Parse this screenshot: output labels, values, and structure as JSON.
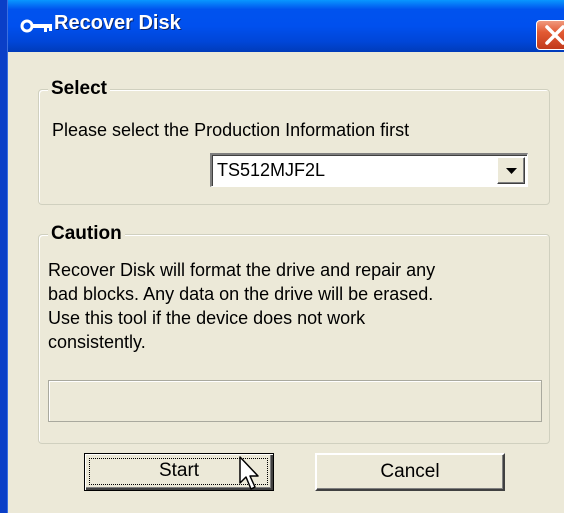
{
  "window": {
    "title": "Recover Disk",
    "icon": "key-icon",
    "close_icon": "close-icon"
  },
  "select_group": {
    "legend": "Select",
    "instruction": "Please select the Production Information first",
    "combo": {
      "value": "TS512MJF2L",
      "arrow_icon": "chevron-down-icon"
    }
  },
  "caution_group": {
    "legend": "Caution",
    "lines": [
      "Recover Disk will format the drive and repair any",
      "bad blocks. Any data on the drive will be erased.",
      "Use this tool if the device does not work",
      "consistently."
    ],
    "progress": 0
  },
  "buttons": {
    "start": "Start",
    "cancel": "Cancel"
  },
  "colors": {
    "titlebar": "#0053ee",
    "dialog_bg": "#ece9d8",
    "close_button": "#e25a33"
  }
}
